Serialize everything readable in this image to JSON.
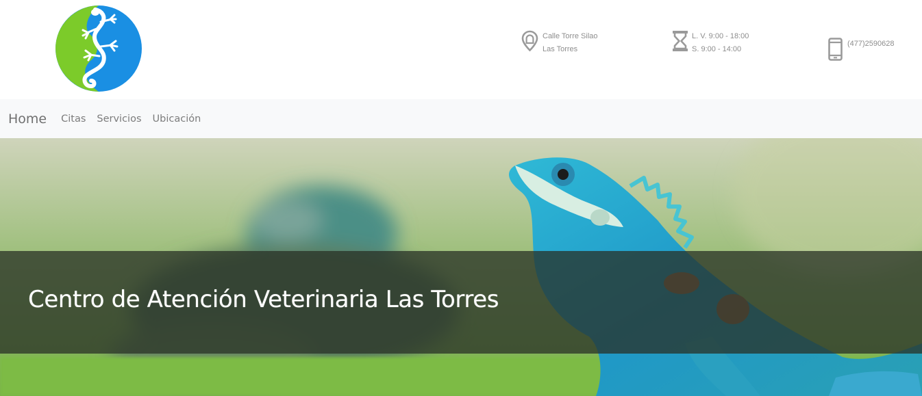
{
  "header": {
    "address_line1": "Calle Torre Silao",
    "address_line2": "Las Torres",
    "hours_weekdays": "L. V. 9:00 - 18:00",
    "hours_saturday": "S. 9:00 - 14:00",
    "phone": "(477)2590628"
  },
  "nav": {
    "brand": "Home",
    "links": [
      "Citas",
      "Servicios",
      "Ubicación"
    ]
  },
  "hero": {
    "title": "Centro de Atención Veterinaria Las Torres"
  },
  "icons": {
    "logo": "lizard-logo",
    "address": "map-pin-icon",
    "hours": "hourglass-icon",
    "phone": "mobile-phone-icon"
  },
  "colors": {
    "logo_green": "#7ccb2a",
    "logo_blue": "#1a8fe3",
    "navbar_bg": "#f8f9fa",
    "info_text": "#8d8d8d",
    "hero_band": "#283026"
  }
}
